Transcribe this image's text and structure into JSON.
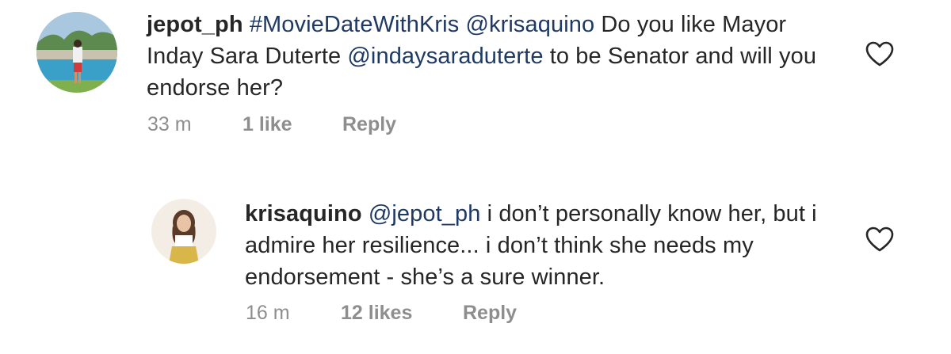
{
  "comments": [
    {
      "username": "jepot_ph",
      "hashtag": "#MovieDateWithKris",
      "mention": "@krisaquino",
      "text_part1": "Do you like Mayor Inday Sara Duterte",
      "mention2": "@indaysaraduterte",
      "text_part2": "to be Senator and will you endorse her?",
      "time": "33 m",
      "likes": "1 like",
      "reply": "Reply",
      "heart_icon": "heart-outline-icon"
    },
    {
      "username": "krisaquino",
      "mention": "@jepot_ph",
      "text": "i don’t personally know her, but i admire her resilience... i don’t think she needs my endorsement - she’s a sure winner.",
      "time": "16 m",
      "likes": "12 likes",
      "reply": "Reply",
      "heart_icon": "heart-outline-icon"
    }
  ],
  "colors": {
    "text": "#262626",
    "secondary": "#8e8e8e",
    "link": "#1e3a64"
  }
}
